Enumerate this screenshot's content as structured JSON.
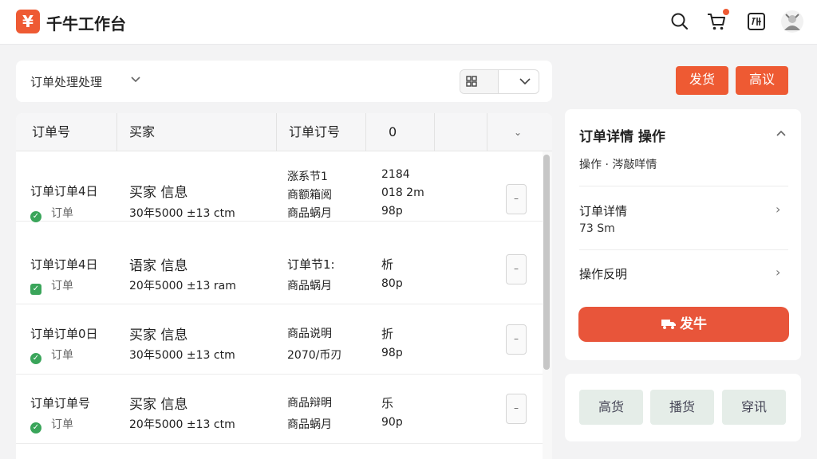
{
  "app": {
    "logo_glyph": "¥",
    "title": "千牛工作台"
  },
  "header_icons": [
    "search-icon",
    "cart-icon",
    "translate-icon",
    "avatar"
  ],
  "filter": {
    "label": "订单处理处理"
  },
  "actions": {
    "ship": "发货",
    "advanced": "高议"
  },
  "table": {
    "columns": [
      "订单号",
      "买家",
      "订单订号",
      "0"
    ],
    "rows": [
      {
        "order": "订单订单4日",
        "status": "订单",
        "buyer": "买家 信息",
        "buyer_detail": "30年5000 ±13 ctm",
        "info": [
          "涨系节1",
          "商额箱阅",
          "商品蜗月"
        ],
        "values": [
          "2184",
          "018 2m",
          "98p"
        ]
      },
      {
        "order": "订单订单4日",
        "status": "订单",
        "buyer": "语家 信息",
        "buyer_detail": "20年5000 ±13 ram",
        "info": [
          "订单节1:",
          "商品蜗月"
        ],
        "values": [
          "析",
          "80p"
        ]
      },
      {
        "order": "订单订单0日",
        "status": "订单",
        "buyer": "买家 信息",
        "buyer_detail": "30年5000 ±13 ctm",
        "info": [
          "商品说明",
          "2070/币刃"
        ],
        "values": [
          "折",
          "98p"
        ]
      },
      {
        "order": "订单订单号",
        "status": "订单",
        "buyer": "买家 信息",
        "buyer_detail": "20年5000 ±13 ctm",
        "info": [
          "商品辩明",
          "商品蜗月"
        ],
        "values": [
          "乐",
          "90p"
        ]
      }
    ]
  },
  "side": {
    "title": "订单详情 操作",
    "subtitle": "操作 · 涔敲咩情",
    "items": [
      {
        "label": "订单详情",
        "value": "73 Sm"
      },
      {
        "label": "操作反明"
      }
    ],
    "ship_button": "发牛"
  },
  "bottom_actions": [
    "高货",
    "播货",
    "穿讯"
  ],
  "colors": {
    "accent": "#ee5a33",
    "success": "#3aa55a",
    "soft_green": "#e5ede8"
  }
}
